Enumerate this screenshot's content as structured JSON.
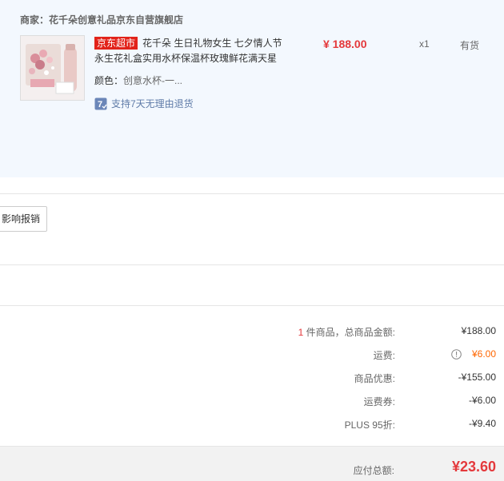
{
  "shop": {
    "label": "商家：",
    "name": "花千朵创意礼品京东自营旗舰店"
  },
  "product": {
    "tag": "京东超市",
    "title": "花千朵 生日礼物女生 七夕情人节永生花礼盒实用水杯保温杯玫瑰鲜花满天星",
    "color_label": "颜色：",
    "color_value": "创意水杯-一...",
    "support_text": "支持7天无理由退货",
    "support_icon": "7-day-return-icon",
    "price": "¥ 188.00",
    "qty": "x1",
    "stock": "有货"
  },
  "actions": {
    "reimburse_label": "影响报销"
  },
  "summary": {
    "item_count": "1",
    "items_label_suffix": " 件商品，总商品金额:",
    "items_total": "¥188.00",
    "shipping_label": "运费:",
    "shipping_value": "¥6.00",
    "discount_label": "商品优惠:",
    "discount_value": "-¥155.00",
    "shipping_coupon_label": "运费券:",
    "shipping_coupon_value": "-¥6.00",
    "plus_label": "PLUS 95折:",
    "plus_value": "-¥9.40",
    "payable_label": "应付总额:",
    "payable_value": "¥23.60"
  },
  "colors": {
    "accent_red": "#e4393c",
    "orange": "#ff6600",
    "panel_bg": "#f3f8fe",
    "link_blue": "#5f7ba8"
  }
}
